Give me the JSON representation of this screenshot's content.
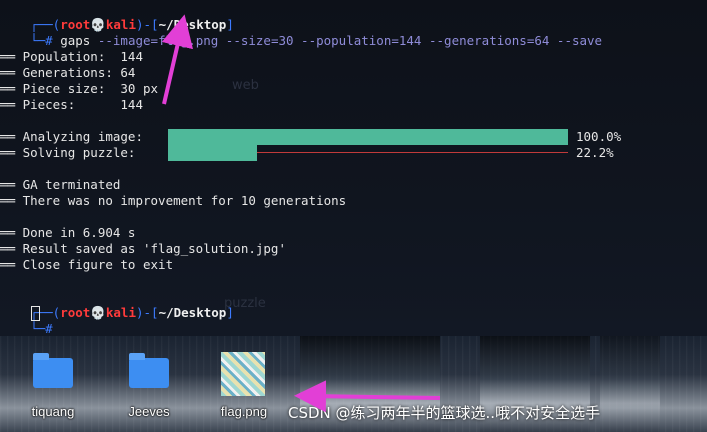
{
  "prompt1": {
    "open": "┌──(",
    "user": "root💀kali",
    "mid": ")-[",
    "path": "~/Desktop",
    "close": "]",
    "hash": "└─#"
  },
  "command": {
    "name": "gaps",
    "args": "--image=flag.png --size=30 --population=144 --generations=64 --save"
  },
  "info": [
    "══ Population:  144",
    "══ Generations: 64",
    "══ Piece size:  30 px",
    "══ Pieces:      144"
  ],
  "progress": [
    {
      "label": "══ Analyzing image:",
      "percent_text": "100.0%",
      "fill": 1.0
    },
    {
      "label": "══ Solving puzzle:",
      "percent_text": "22.2%",
      "fill": 0.222
    }
  ],
  "status": [
    "══ GA terminated",
    "══ There was no improvement for 10 generations"
  ],
  "done": [
    "══ Done in 6.904 s",
    "══ Result saved as 'flag_solution.jpg'",
    "══ Close figure to exit"
  ],
  "prompt2": {
    "open": "┌──(",
    "user": "root💀kali",
    "mid": ")-[",
    "path": "~/Desktop",
    "close": "]",
    "hash": "└─#"
  },
  "background_text": {
    "web": "web",
    "puzzle": "puzzle"
  },
  "desktop": {
    "icons": [
      {
        "label": "tiquang",
        "type": "folder"
      },
      {
        "label": "Jeeves",
        "type": "folder"
      },
      {
        "label": "flag.png",
        "type": "image"
      }
    ]
  },
  "watermark": "CSDN @练习两年半的篮球选..哦不对安全选手",
  "colors": {
    "progress_fill": "#4fb99a",
    "prompt_red": "#ff3b3b",
    "prompt_blue": "#3d7bff",
    "arrow": "#e23fd6"
  }
}
